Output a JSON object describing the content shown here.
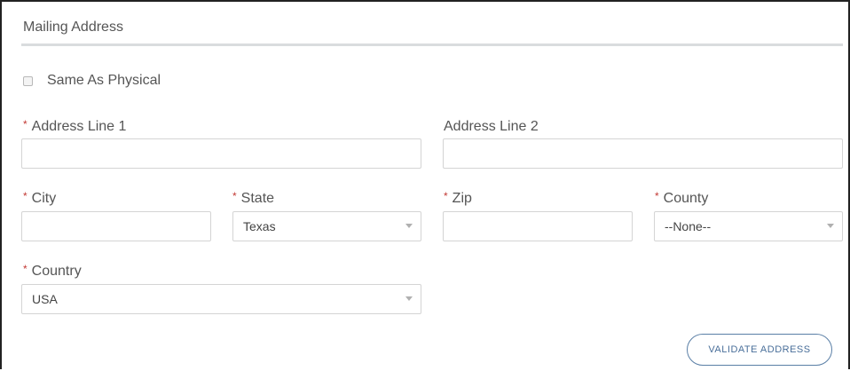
{
  "section": {
    "title": "Mailing Address"
  },
  "same_as_physical": {
    "label": "Same As Physical",
    "checked": false
  },
  "required_marker": "*",
  "fields": {
    "address_line_1": {
      "label": "Address Line 1",
      "value": "",
      "required": true
    },
    "address_line_2": {
      "label": "Address Line 2",
      "value": "",
      "required": false
    },
    "city": {
      "label": "City",
      "value": "",
      "required": true
    },
    "state": {
      "label": "State",
      "value": "Texas",
      "required": true
    },
    "zip": {
      "label": "Zip",
      "value": "",
      "required": true
    },
    "county": {
      "label": "County",
      "value": "--None--",
      "required": true
    },
    "country": {
      "label": "Country",
      "value": "USA",
      "required": true
    }
  },
  "validate_button": {
    "label": "VALIDATE ADDRESS"
  },
  "colors": {
    "required_marker": "#c23934",
    "button_border": "#5a7fa6",
    "button_text": "#4a6f9a",
    "section_rule": "#d9dcde"
  },
  "icons": {
    "select_chevron": "chevron-down-icon"
  }
}
